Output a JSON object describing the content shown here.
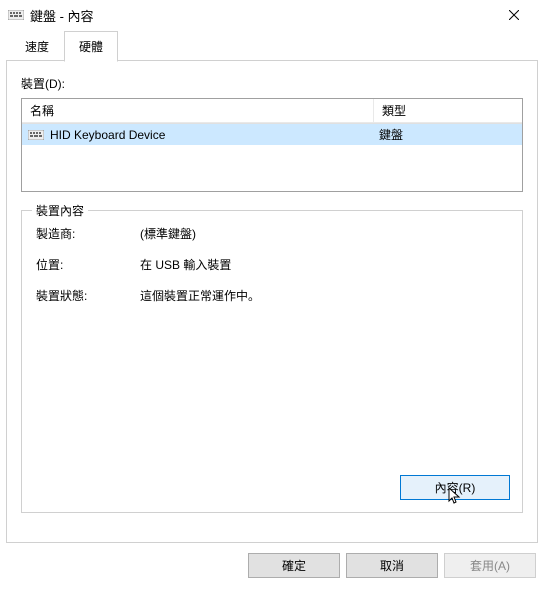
{
  "titlebar": {
    "title": "鍵盤 - 內容",
    "close_aria": "Close"
  },
  "tabs": {
    "speed": "速度",
    "hardware": "硬體"
  },
  "devices": {
    "caption": "裝置(D):",
    "header": {
      "name": "名稱",
      "type": "類型"
    },
    "rows": [
      {
        "name": "HID Keyboard Device",
        "type": "鍵盤"
      }
    ]
  },
  "details": {
    "legend": "裝置內容",
    "rows": {
      "manufacturer": {
        "label": "製造商:",
        "value": "(標準鍵盤)"
      },
      "location": {
        "label": "位置:",
        "value": "在 USB 輸入裝置"
      },
      "status": {
        "label": "裝置狀態:",
        "value": "這個裝置正常運作中。"
      }
    },
    "properties_button": "內容(R)"
  },
  "footer": {
    "ok": "確定",
    "cancel": "取消",
    "apply": "套用(A)"
  }
}
